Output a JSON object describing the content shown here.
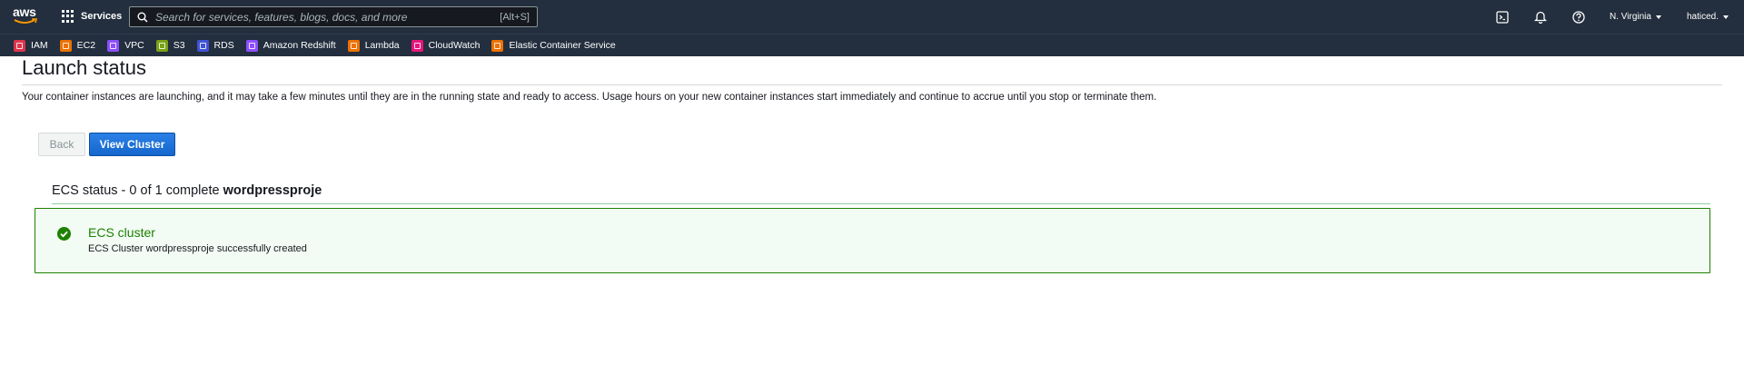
{
  "topbar": {
    "logo_text": "aws",
    "services_label": "Services",
    "search_placeholder": "Search for services, features, blogs, docs, and more",
    "search_shortcut": "[Alt+S]",
    "region": "N. Virginia",
    "account": "haticed."
  },
  "favorites": [
    {
      "label": "IAM",
      "icon": "iam-icon",
      "color": "#dd344c"
    },
    {
      "label": "EC2",
      "icon": "ec2-icon",
      "color": "#ed7100"
    },
    {
      "label": "VPC",
      "icon": "vpc-icon",
      "color": "#8c4fff"
    },
    {
      "label": "S3",
      "icon": "s3-icon",
      "color": "#7aa116"
    },
    {
      "label": "RDS",
      "icon": "rds-icon",
      "color": "#4053d6"
    },
    {
      "label": "Amazon Redshift",
      "icon": "redshift-icon",
      "color": "#8c4fff"
    },
    {
      "label": "Lambda",
      "icon": "lambda-icon",
      "color": "#ed7100"
    },
    {
      "label": "CloudWatch",
      "icon": "cloudwatch-icon",
      "color": "#e7157b"
    },
    {
      "label": "Elastic Container Service",
      "icon": "ecs-icon",
      "color": "#ed7100"
    }
  ],
  "main": {
    "title": "Launch status",
    "description": "Your container instances are launching, and it may take a few minutes until they are in the running state and ready to access. Usage hours on your new container instances start immediately and continue to accrue until you stop or terminate them.",
    "back_label": "Back",
    "view_cluster_label": "View Cluster",
    "ecs_status_prefix": "ECS status - 0 of 1 complete ",
    "ecs_status_name": "wordpressproje",
    "result": {
      "title": "ECS cluster",
      "detail": "ECS Cluster wordpressproje successfully created",
      "status_color": "#1d8102"
    }
  }
}
